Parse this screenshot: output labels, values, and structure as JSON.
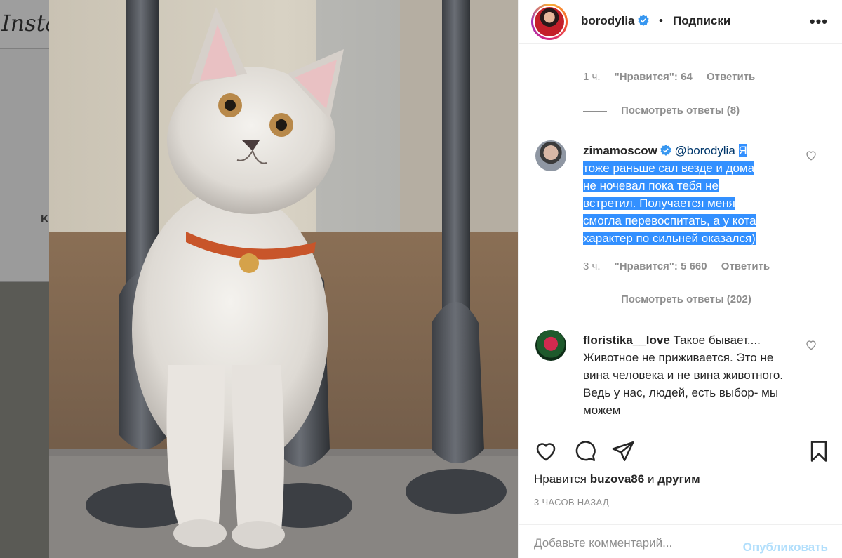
{
  "background": {
    "logo": "Instagram",
    "profile_initial": "K"
  },
  "header": {
    "username": "borodylia",
    "dot": "•",
    "follow_label": "Подписки",
    "more": "•••"
  },
  "comments": [
    {
      "meta": {
        "time": "1 ч.",
        "likes": "\"Нравится\": 64",
        "reply": "Ответить"
      },
      "replies": {
        "label": "Посмотреть ответы (8)"
      }
    },
    {
      "username": "zimamoscow",
      "mention": "@borodylia",
      "text": "Я тоже раньше сал везде и дома не ночевал пока тебя не встретил. Получается меня смогла перевоспитать, а у кота характер по сильней оказался)",
      "text_lines": [
        "Я",
        "тоже раньше сал везде и дома",
        "не ночевал пока тебя не",
        "встретил. Получается меня",
        "смогла перевоспитать, а у кота",
        "характер по сильней оказался)"
      ],
      "meta": {
        "time": "3 ч.",
        "likes": "\"Нравится\": 5 660",
        "reply": "Ответить"
      },
      "replies": {
        "label": "Посмотреть ответы (202)"
      }
    },
    {
      "username": "floristika__love",
      "text": "Такое бывает.... Животное не приживается. Это не вина человека и не вина животного. Ведь у нас, людей, есть выбор- мы можем"
    }
  ],
  "footer": {
    "likes_prefix": "Нравится",
    "likes_user": "buzova86",
    "likes_suffix": "и",
    "likes_others": "другим",
    "time": "3 ЧАСОВ НАЗАД",
    "comment_placeholder": "Добавьте комментарий...",
    "publish_label": "Опубликовать"
  },
  "colors": {
    "verified": "#3897f0",
    "selection": "#3390ff",
    "publish_disabled": "#b2dffc"
  }
}
